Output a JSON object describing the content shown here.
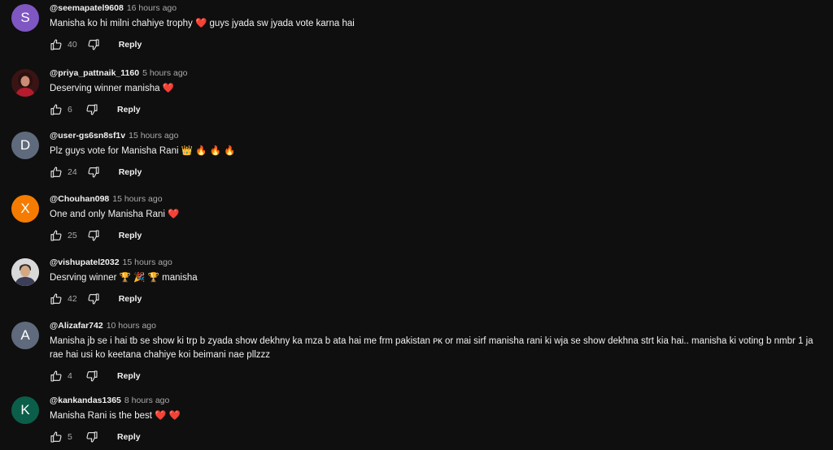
{
  "comments": [
    {
      "author": "@seemapatel9608",
      "time": "16 hours ago",
      "text": "Manisha ko hi milni chahiye trophy ❤️  guys jyada sw jyada vote karna hai",
      "likes": "40",
      "reply": "Reply",
      "avatar_letter": "S",
      "avatar_color": "#7e57c2"
    },
    {
      "author": "@priya_pattnaik_1160",
      "time": "5 hours ago",
      "text": "Deserving winner manisha ❤️",
      "likes": "6",
      "reply": "Reply",
      "avatar_letter": "",
      "avatar_color": "#3a1414"
    },
    {
      "author": "@user-gs6sn8sf1v",
      "time": "15 hours ago",
      "text": "Plz guys vote for Manisha Rani 👑 🔥 🔥 🔥",
      "likes": "24",
      "reply": "Reply",
      "avatar_letter": "D",
      "avatar_color": "#5f6b7c"
    },
    {
      "author": "@Chouhan098",
      "time": "15 hours ago",
      "text": "One and only Manisha Rani ❤️",
      "likes": "25",
      "reply": "Reply",
      "avatar_letter": "X",
      "avatar_color": "#f57c00"
    },
    {
      "author": "@vishupatel2032",
      "time": "15 hours ago",
      "text": "Desrving winner 🏆 🎉 🏆 manisha",
      "likes": "42",
      "reply": "Reply",
      "avatar_letter": "",
      "avatar_color": "#d9d9d9"
    },
    {
      "author": "@Alizafar742",
      "time": "10 hours ago",
      "text": "Manisha jb se i hai tb se show ki trp b zyada show dekhny ka mza b ata hai me frm pakistan ᴘᴋ or mai sirf manisha rani ki wja se show dekhna strt kia hai.. manisha ki voting b nmbr 1 ja rae hai usi ko keetana chahiye koi beimani nae pllzzz",
      "likes": "4",
      "reply": "Reply",
      "avatar_letter": "A",
      "avatar_color": "#5f6b7c"
    },
    {
      "author": "@kankandas1365",
      "time": "8 hours ago",
      "text": "Manisha Rani is the best ❤️ ❤️",
      "likes": "5",
      "reply": "Reply",
      "avatar_letter": "K",
      "avatar_color": "#0b5e4a"
    }
  ]
}
